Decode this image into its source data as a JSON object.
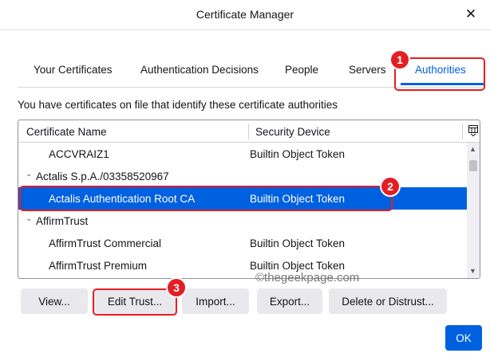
{
  "window": {
    "title": "Certificate Manager",
    "close_glyph": "✕"
  },
  "tabs": [
    {
      "label": "Your Certificates"
    },
    {
      "label": "Authentication Decisions"
    },
    {
      "label": "People"
    },
    {
      "label": "Servers"
    },
    {
      "label": "Authorities"
    }
  ],
  "description": "You have certificates on file that identify these certificate authorities",
  "tree": {
    "columns": [
      "Certificate Name",
      "Security Device"
    ],
    "rows": [
      {
        "name": "ACCVRAIZ1",
        "device": "Builtin Object Token"
      },
      {
        "name": "Actalis S.p.A./03358520967",
        "device": ""
      },
      {
        "name": "Actalis Authentication Root CA",
        "device": "Builtin Object Token"
      },
      {
        "name": "AffirmTrust",
        "device": ""
      },
      {
        "name": "AffirmTrust Commercial",
        "device": "Builtin Object Token"
      },
      {
        "name": "AffirmTrust Premium",
        "device": "Builtin Object Token"
      }
    ]
  },
  "buttons": {
    "view": "View...",
    "edit_trust": "Edit Trust...",
    "import": "Import...",
    "export": "Export...",
    "delete": "Delete or Distrust...",
    "ok": "OK"
  },
  "watermark": "©thegeekpage.com",
  "callouts": [
    "1",
    "2",
    "3"
  ],
  "colors": {
    "accent": "#0061e0",
    "callout": "#e31e24"
  }
}
